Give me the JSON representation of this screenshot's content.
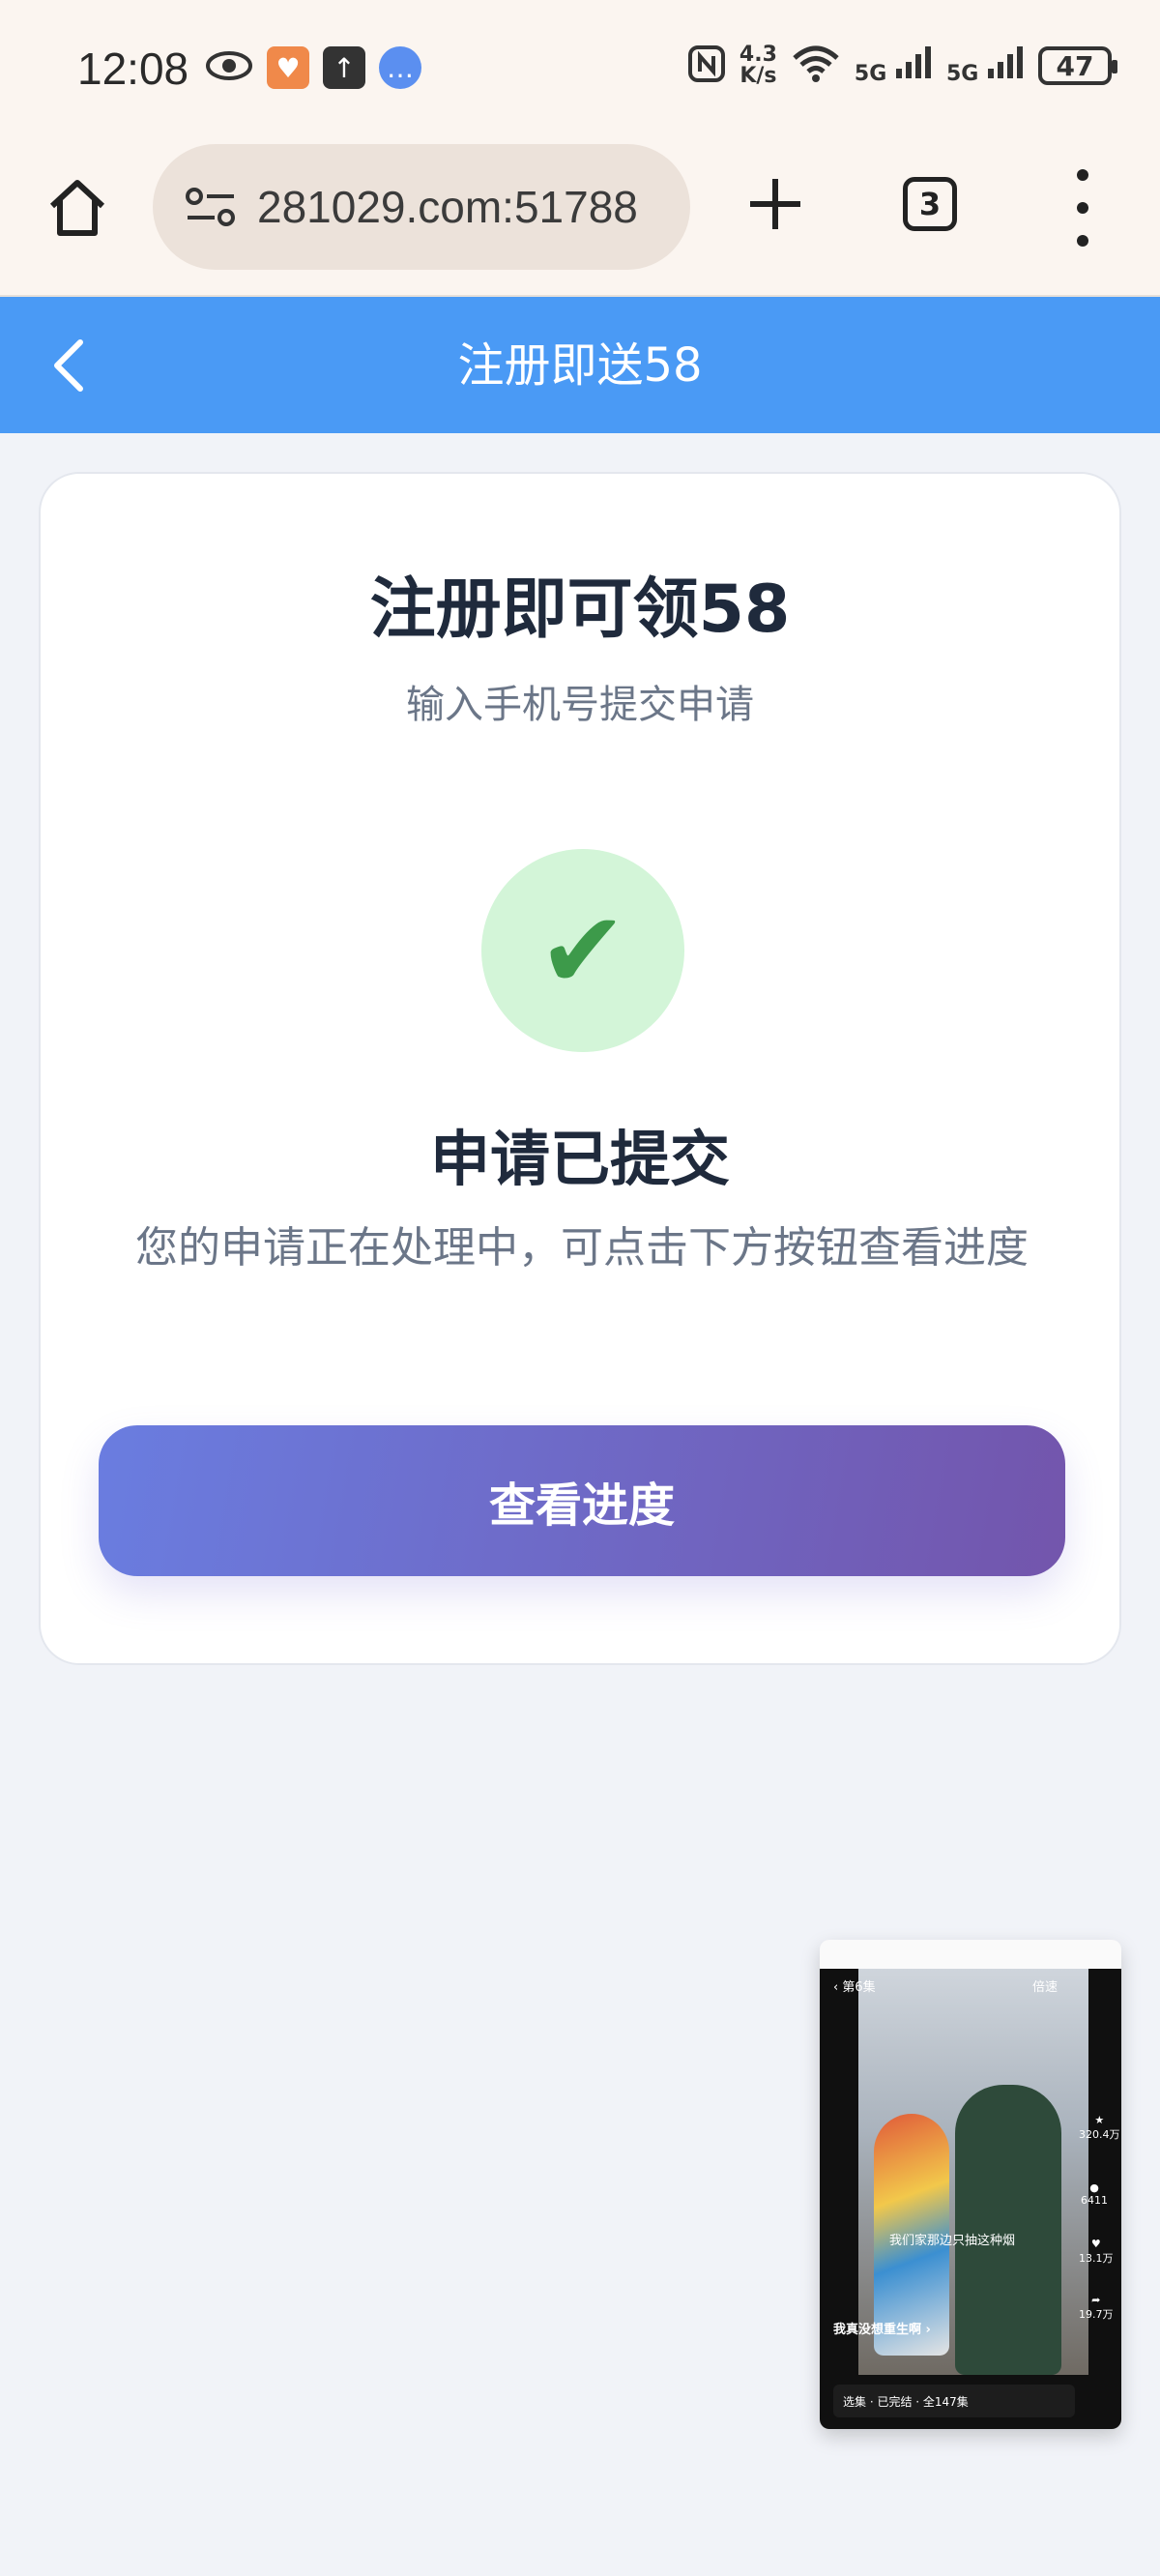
{
  "status_bar": {
    "time": "12:08",
    "net_speed_value": "4.3",
    "net_speed_unit": "K/s",
    "signal1": "5G",
    "signal2": "5G",
    "battery": "47"
  },
  "browser": {
    "url": "281029.com:51788",
    "tab_count": "3"
  },
  "header": {
    "title": "注册即送58"
  },
  "card": {
    "title": "注册即可领58",
    "subtitle": "输入手机号提交申请",
    "status_title": "申请已提交",
    "status_desc": "您的申请正在处理中，可点击下方按钮查看进度",
    "button_label": "查看进度"
  },
  "video": {
    "episode": "第6集",
    "speed_label": "倍速",
    "caption": "我们家那边只抽这种烟",
    "series_title": "我真没想重生啊 ›",
    "likes_star": "320.4万",
    "comments": "6411",
    "hearts": "13.1万",
    "shares": "19.7万",
    "bottom_bar": "选集 · 已完结 · 全147集"
  }
}
